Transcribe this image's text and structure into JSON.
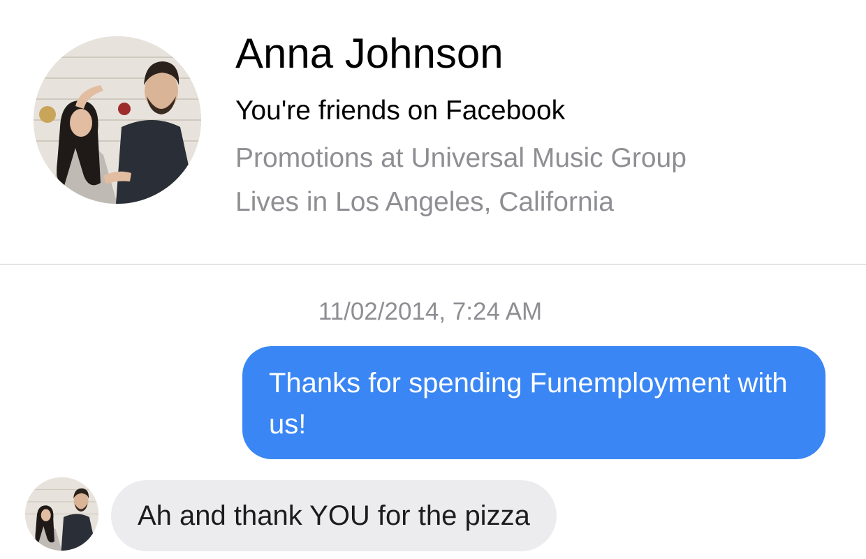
{
  "profile": {
    "name": "Anna Johnson",
    "relation": "You're friends on Facebook",
    "work": "Promotions at Universal Music Group",
    "location": "Lives in Los Angeles, California",
    "avatar_icon": "profile-photo"
  },
  "conversation": {
    "timestamp": "11/02/2014, 7:24 AM",
    "messages": [
      {
        "direction": "outgoing",
        "text": "Thanks for spending Funemployment with us!"
      },
      {
        "direction": "incoming",
        "text": "Ah and thank YOU for the pizza"
      }
    ]
  },
  "colors": {
    "outgoing_bubble": "#3a86f4",
    "incoming_bubble": "#ececee",
    "secondary_text": "#8e8e93",
    "divider": "#c8c7cc"
  }
}
